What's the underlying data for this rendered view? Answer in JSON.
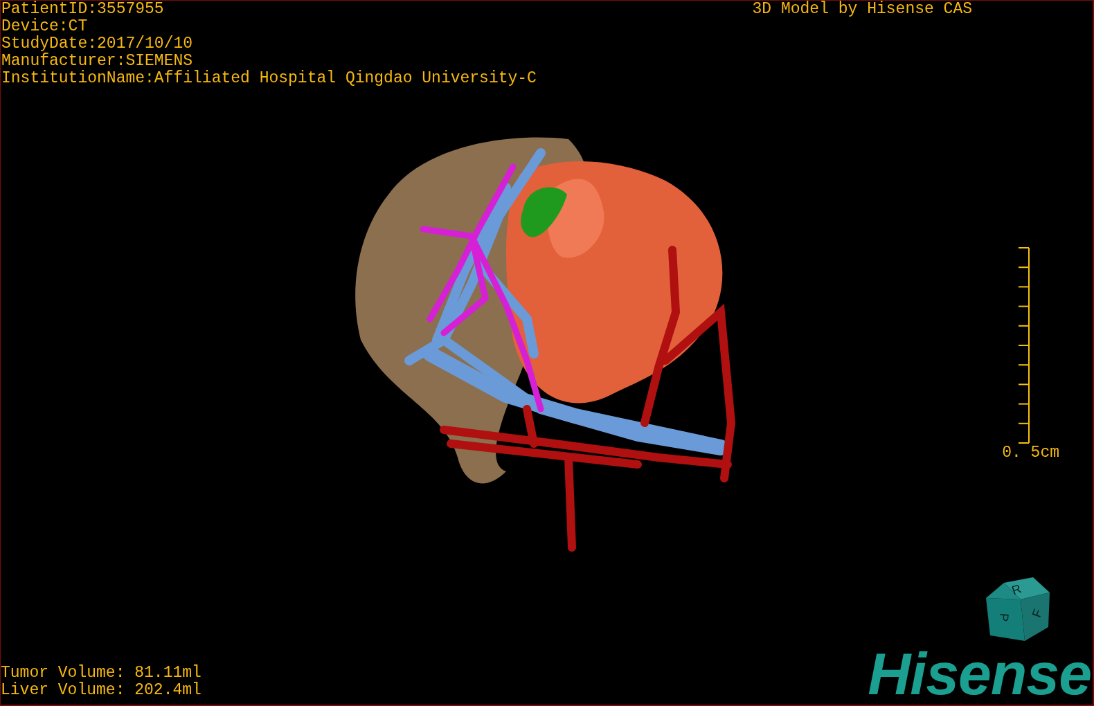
{
  "viewport": {
    "info_lines": [
      "PatientID:3557955",
      "Device:CT",
      "StudyDate:2017/10/10",
      "Manufacturer:SIEMENS",
      "InstitutionName:Affiliated Hospital Qingdao University-C"
    ],
    "title": "3D Model by Hisense CAS",
    "scale_bar": {
      "label": "0. 5cm"
    },
    "orientation_cube": {
      "faces": [
        "R",
        "F",
        "P"
      ]
    },
    "volumes": [
      "Tumor Volume: 81.11ml",
      "Liver Volume: 202.4ml"
    ],
    "logo": "Hisense"
  }
}
